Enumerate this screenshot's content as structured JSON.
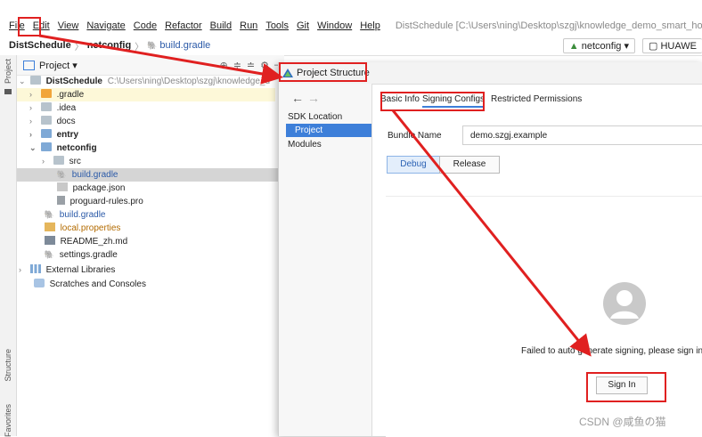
{
  "menubar": {
    "items": [
      {
        "label": "File"
      },
      {
        "label": "Edit"
      },
      {
        "label": "View"
      },
      {
        "label": "Navigate"
      },
      {
        "label": "Code"
      },
      {
        "label": "Refactor"
      },
      {
        "label": "Build"
      },
      {
        "label": "Run"
      },
      {
        "label": "Tools"
      },
      {
        "label": "Git"
      },
      {
        "label": "Window"
      },
      {
        "label": "Help"
      }
    ],
    "window_title": "DistSchedule [C:\\Users\\ning\\Desktop\\szgj\\knowledge_demo_smart_home\\FA"
  },
  "navbar": {
    "crumbs": [
      "DistSchedule",
      "netconfig",
      "build.gradle"
    ],
    "run_config": "netconfig ▾",
    "device": "HUAWE"
  },
  "toolstrip": {
    "project": "Project",
    "structure": "Structure",
    "favorites": "Favorites"
  },
  "project_panel": {
    "title": "Project ▾",
    "root_name": "DistSchedule",
    "root_path": "C:\\Users\\ning\\Desktop\\szgj\\knowledge_d",
    "items": [
      {
        "label": ".gradle"
      },
      {
        "label": ".idea"
      },
      {
        "label": "docs"
      },
      {
        "label": "entry"
      },
      {
        "label": "netconfig"
      },
      {
        "label": "src"
      },
      {
        "label": "build.gradle"
      },
      {
        "label": "package.json"
      },
      {
        "label": "proguard-rules.pro"
      },
      {
        "label": "build.gradle"
      },
      {
        "label": "local.properties"
      },
      {
        "label": "README_zh.md"
      },
      {
        "label": "settings.gradle"
      },
      {
        "label": "External Libraries"
      },
      {
        "label": "Scratches and Consoles"
      }
    ]
  },
  "dialog": {
    "title": "Project Structure",
    "nav": {
      "back": "←",
      "forward": "→",
      "items": [
        "SDK Location",
        "Project",
        "Modules"
      ]
    },
    "tabs": [
      "Basic Info",
      "Signing Configs",
      "Restricted Permissions"
    ],
    "bundle_label": "Bundle Name",
    "bundle_value": "demo.szgj.example",
    "build_types": [
      "Debug",
      "Release"
    ],
    "sign_message": "Failed to auto generate signing, please sign in",
    "sign_in_label": "Sign In"
  },
  "watermark": "CSDN @咸鱼の猫",
  "colors": {
    "accent": "#3d7fd9",
    "annotation": "#e02020",
    "selection": "#d5d5d5"
  }
}
